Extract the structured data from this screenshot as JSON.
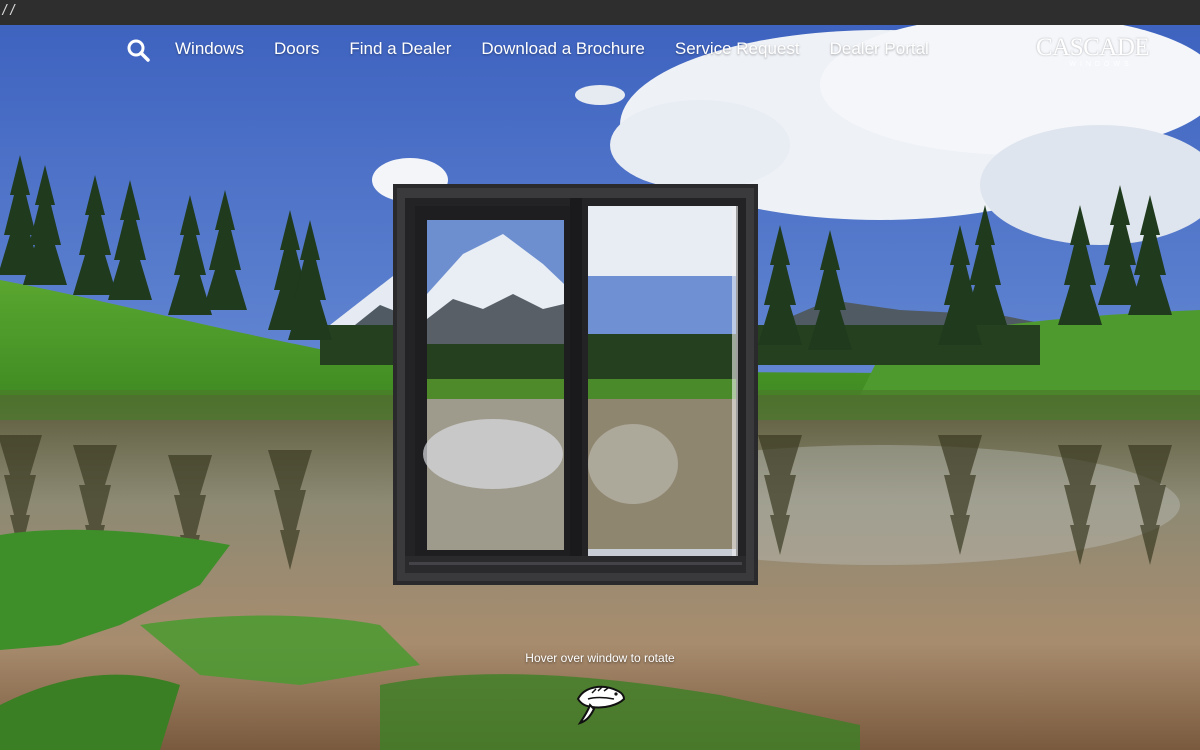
{
  "top_strip_text": "//",
  "nav": {
    "search_icon": "search-icon",
    "links": [
      "Windows",
      "Doors",
      "Find a Dealer",
      "Download a Brochure",
      "Service Request",
      "Dealer Portal"
    ]
  },
  "logo": {
    "main": "CASCADE",
    "sub": "WINDOWS"
  },
  "hint": "Hover over window to rotate",
  "fish_icon": "salmon-icon",
  "colors": {
    "sky": "#4a6fc4",
    "frame": "#2a2a2c",
    "nav_text": "#ffffff"
  }
}
